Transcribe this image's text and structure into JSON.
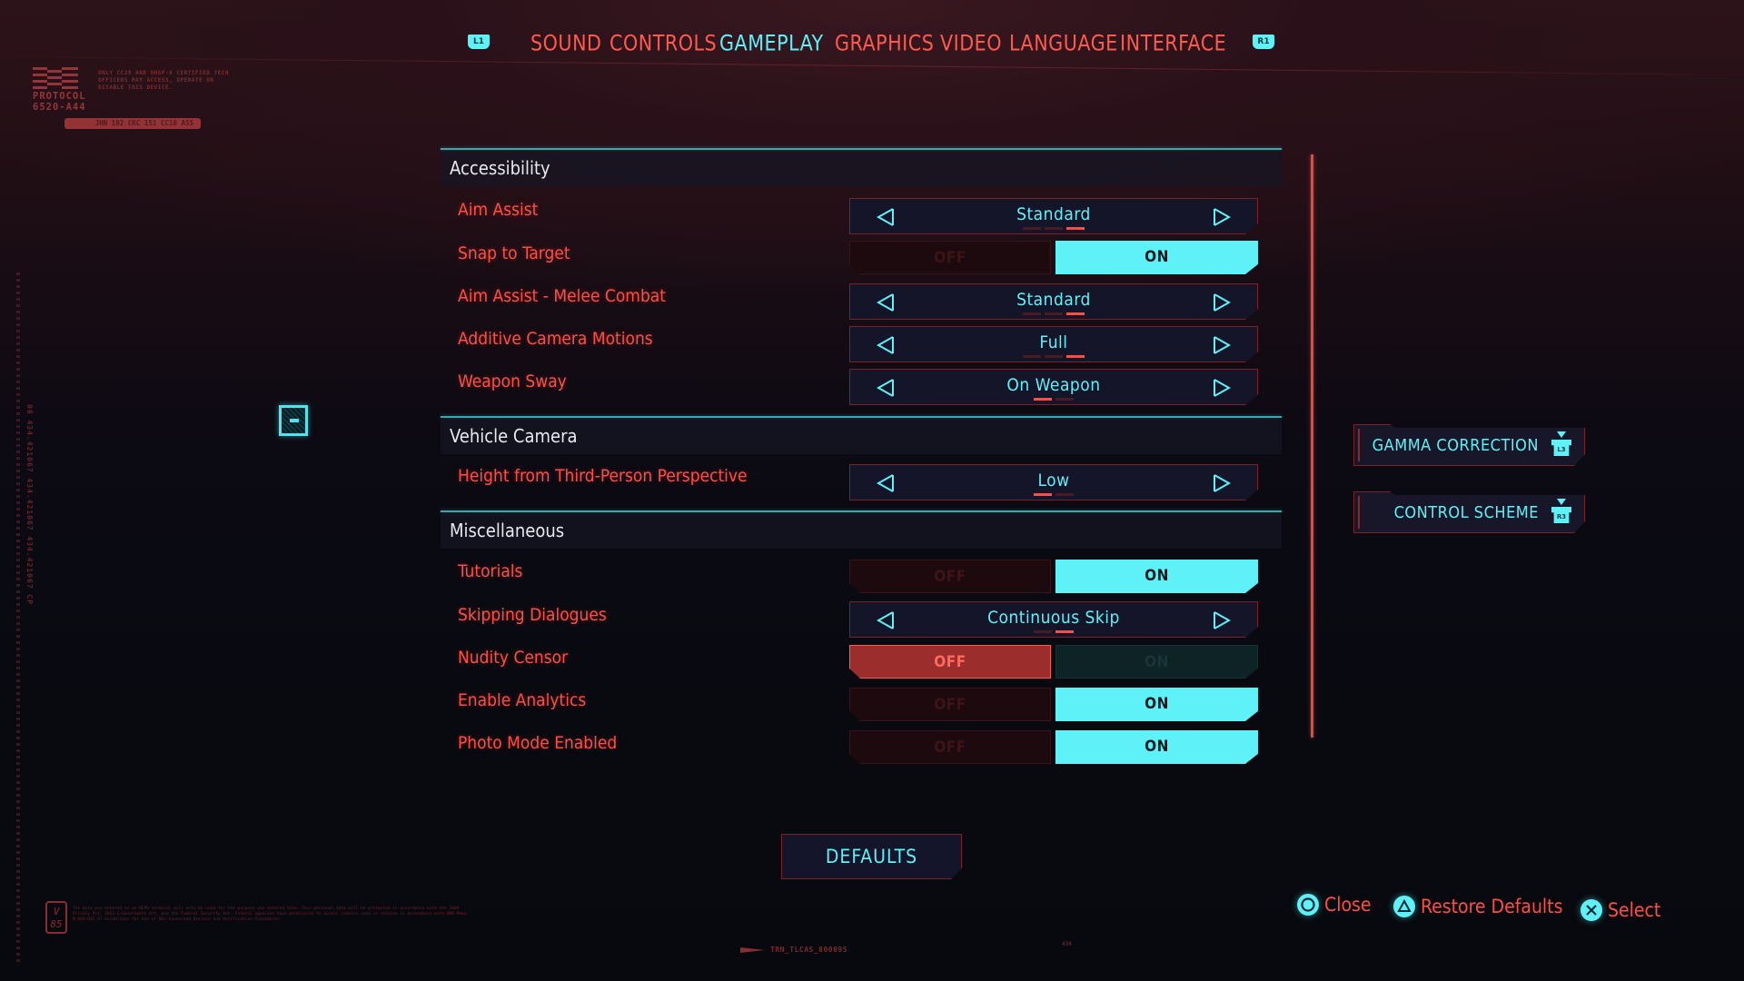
{
  "tabs": {
    "left_bumper": "L1",
    "right_bumper": "R1",
    "items": [
      {
        "label": "SOUND",
        "active": false
      },
      {
        "label": "CONTROLS",
        "active": false
      },
      {
        "label": "GAMEPLAY",
        "active": true
      },
      {
        "label": "GRAPHICS",
        "active": false
      },
      {
        "label": "VIDEO",
        "active": false
      },
      {
        "label": "LANGUAGE",
        "active": false
      },
      {
        "label": "INTERFACE",
        "active": false
      }
    ]
  },
  "protocol": {
    "title": "PROTOCOL\n6520-A44",
    "notice": "ONLY CC28 AND OHSF-8 CERTIFIED TECH OFFICERS MAY ACCESS, OPERATE OR DISABLE THIS DEVICE.",
    "tag": "JHN 102 CKC 151 CC10 ASS"
  },
  "side_vertical_text": "08 434.421067 434.421067 434.421067 CP",
  "sections": [
    {
      "title": "Accessibility",
      "rows": [
        {
          "label": "Aim Assist",
          "type": "selector",
          "value": "Standard",
          "option_count": 3,
          "selected_index": 2
        },
        {
          "label": "Snap to Target",
          "type": "toggle",
          "off_label": "OFF",
          "on_label": "ON",
          "value": "ON"
        },
        {
          "label": "Aim Assist - Melee Combat",
          "type": "selector",
          "value": "Standard",
          "option_count": 3,
          "selected_index": 2
        },
        {
          "label": "Additive Camera Motions",
          "type": "selector",
          "value": "Full",
          "option_count": 3,
          "selected_index": 2
        },
        {
          "label": "Weapon Sway",
          "type": "selector",
          "value": "On Weapon",
          "option_count": 2,
          "selected_index": 0
        }
      ]
    },
    {
      "title": "Vehicle Camera",
      "rows": [
        {
          "label": "Height from Third-Person Perspective",
          "type": "selector",
          "value": "Low",
          "option_count": 2,
          "selected_index": 0
        }
      ]
    },
    {
      "title": "Miscellaneous",
      "rows": [
        {
          "label": "Tutorials",
          "type": "toggle",
          "off_label": "OFF",
          "on_label": "ON",
          "value": "ON"
        },
        {
          "label": "Skipping Dialogues",
          "type": "selector",
          "value": "Continuous Skip",
          "option_count": 2,
          "selected_index": 1
        },
        {
          "label": "Nudity Censor",
          "type": "toggle",
          "off_label": "OFF",
          "on_label": "ON",
          "value": "OFF"
        },
        {
          "label": "Enable Analytics",
          "type": "toggle",
          "off_label": "OFF",
          "on_label": "ON",
          "value": "ON"
        },
        {
          "label": "Photo Mode Enabled",
          "type": "toggle",
          "off_label": "OFF",
          "on_label": "ON",
          "value": "ON"
        }
      ]
    }
  ],
  "side_buttons": [
    {
      "label": "GAMMA CORRECTION",
      "button": "L3"
    },
    {
      "label": "CONTROL SCHEME",
      "button": "R3"
    }
  ],
  "defaults_button": "DEFAULTS",
  "hints": [
    {
      "button": "circle",
      "label": "Close"
    },
    {
      "button": "triangle",
      "label": "Restore Defaults"
    },
    {
      "button": "cross",
      "label": "Select"
    }
  ],
  "footer": {
    "badge": "V\n85",
    "fineprint": "The Data you entered on an NCPD terminal will only be used for the purpose you entered them. Your personal data will be protected in accordance with the 2069 Privacy Act, 2053 E-Government Act, and the Federal Security Act. Federal agencies have permission to access cookies used in session in accordance with OMB Memo M-069-042 AT Guidelines for Use of Non-Connected Devices and Verification Procedures.",
    "code": "TRN_TLCAS_800095",
    "marker": "434"
  },
  "colors": {
    "accent_cyan": "#5ef2f8",
    "accent_red": "#ff4f45",
    "header_text": "#e8e8ef",
    "section_line": "#3aa8b0"
  }
}
